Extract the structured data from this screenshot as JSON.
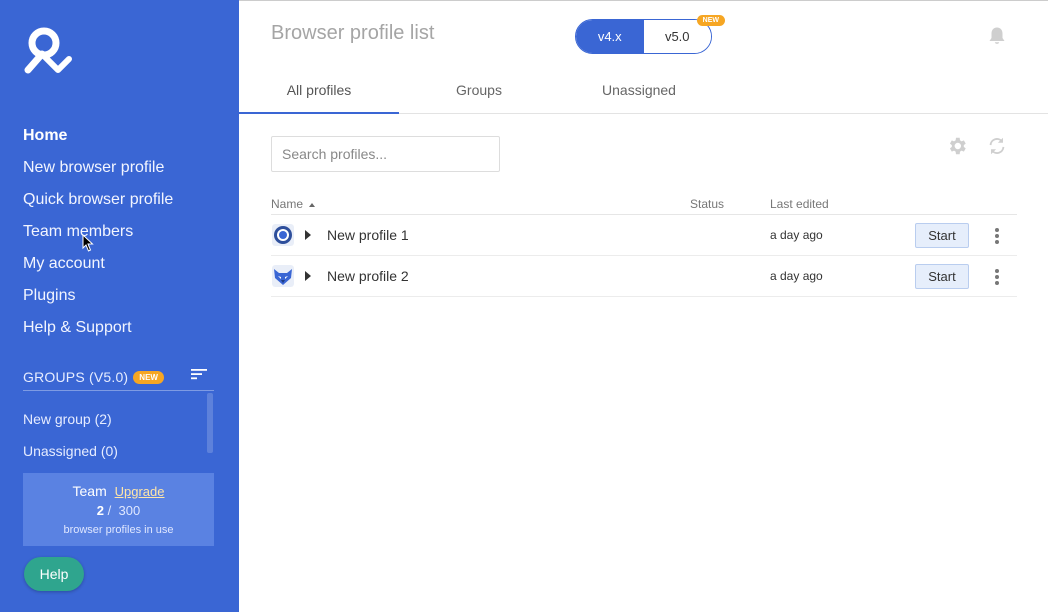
{
  "sidebar": {
    "nav": [
      {
        "label": "Home",
        "active": true
      },
      {
        "label": "New browser profile"
      },
      {
        "label": "Quick browser profile"
      },
      {
        "label": "Team members"
      },
      {
        "label": "My account"
      },
      {
        "label": "Plugins"
      },
      {
        "label": "Help & Support"
      }
    ],
    "groups_title": "GROUPS (V5.0)",
    "groups_badge": "NEW",
    "groups": [
      {
        "label": "New group (2)"
      },
      {
        "label": "Unassigned (0)"
      }
    ],
    "plan": {
      "name": "Team",
      "upgrade_label": "Upgrade",
      "used": "2",
      "separator": "/",
      "total": "300",
      "caption": "browser profiles in use"
    },
    "help_label": "Help"
  },
  "header": {
    "title": "Browser profile list",
    "version_on": "v4.x",
    "version_off": "v5.0",
    "version_badge": "NEW"
  },
  "tabs": [
    {
      "label": "All profiles",
      "active": true
    },
    {
      "label": "Groups"
    },
    {
      "label": "Unassigned"
    }
  ],
  "search": {
    "placeholder": "Search profiles..."
  },
  "table": {
    "columns": {
      "name": "Name",
      "status": "Status",
      "edited": "Last edited"
    },
    "rows": [
      {
        "name": "New profile 1",
        "status": "",
        "edited": "a day ago",
        "action": "Start",
        "icon": "orbita-browser-icon"
      },
      {
        "name": "New profile 2",
        "status": "",
        "edited": "a day ago",
        "action": "Start",
        "icon": "fox-browser-icon"
      }
    ]
  },
  "colors": {
    "sidebar": "#3a66d4",
    "accent": "#3a66d4",
    "badge": "#f6a623",
    "help": "#2fa58e"
  }
}
